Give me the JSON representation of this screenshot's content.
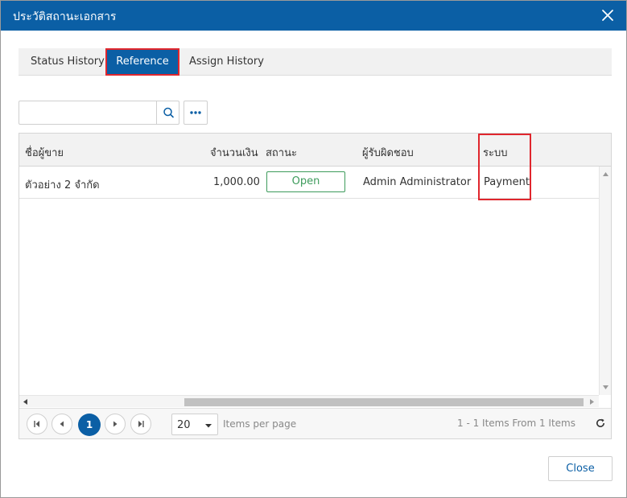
{
  "dialog": {
    "title": "ประวัติสถานะเอกสาร",
    "close_label": "Close"
  },
  "tabs": [
    {
      "label": "Status History",
      "active": false
    },
    {
      "label": "Reference",
      "active": true
    },
    {
      "label": "Assign History",
      "active": false
    }
  ],
  "search": {
    "value": "",
    "placeholder": ""
  },
  "grid": {
    "columns": [
      "ชื่อผู้ขาย",
      "จำนวนเงิน",
      "สถานะ",
      "ผู้รับผิดชอบ",
      "ระบบ"
    ],
    "rows": [
      {
        "vendor": "ตัวอย่าง 2 จำกัด",
        "amount": "1,000.00",
        "status": "Open",
        "owner": "Admin Administrator",
        "system": "Payment"
      }
    ]
  },
  "pager": {
    "current_page": "1",
    "page_size": "20",
    "items_per_page_label": "Items per page",
    "info": "1 - 1 Items From 1 Items"
  },
  "colors": {
    "primary": "#0b5fa5",
    "highlight": "#e0262d",
    "status_open": "#3d9b5b"
  },
  "icons": [
    "close-icon",
    "search-icon",
    "ellipsis-icon",
    "first-page-icon",
    "prev-page-icon",
    "next-page-icon",
    "last-page-icon",
    "chevron-down-icon",
    "refresh-icon"
  ]
}
